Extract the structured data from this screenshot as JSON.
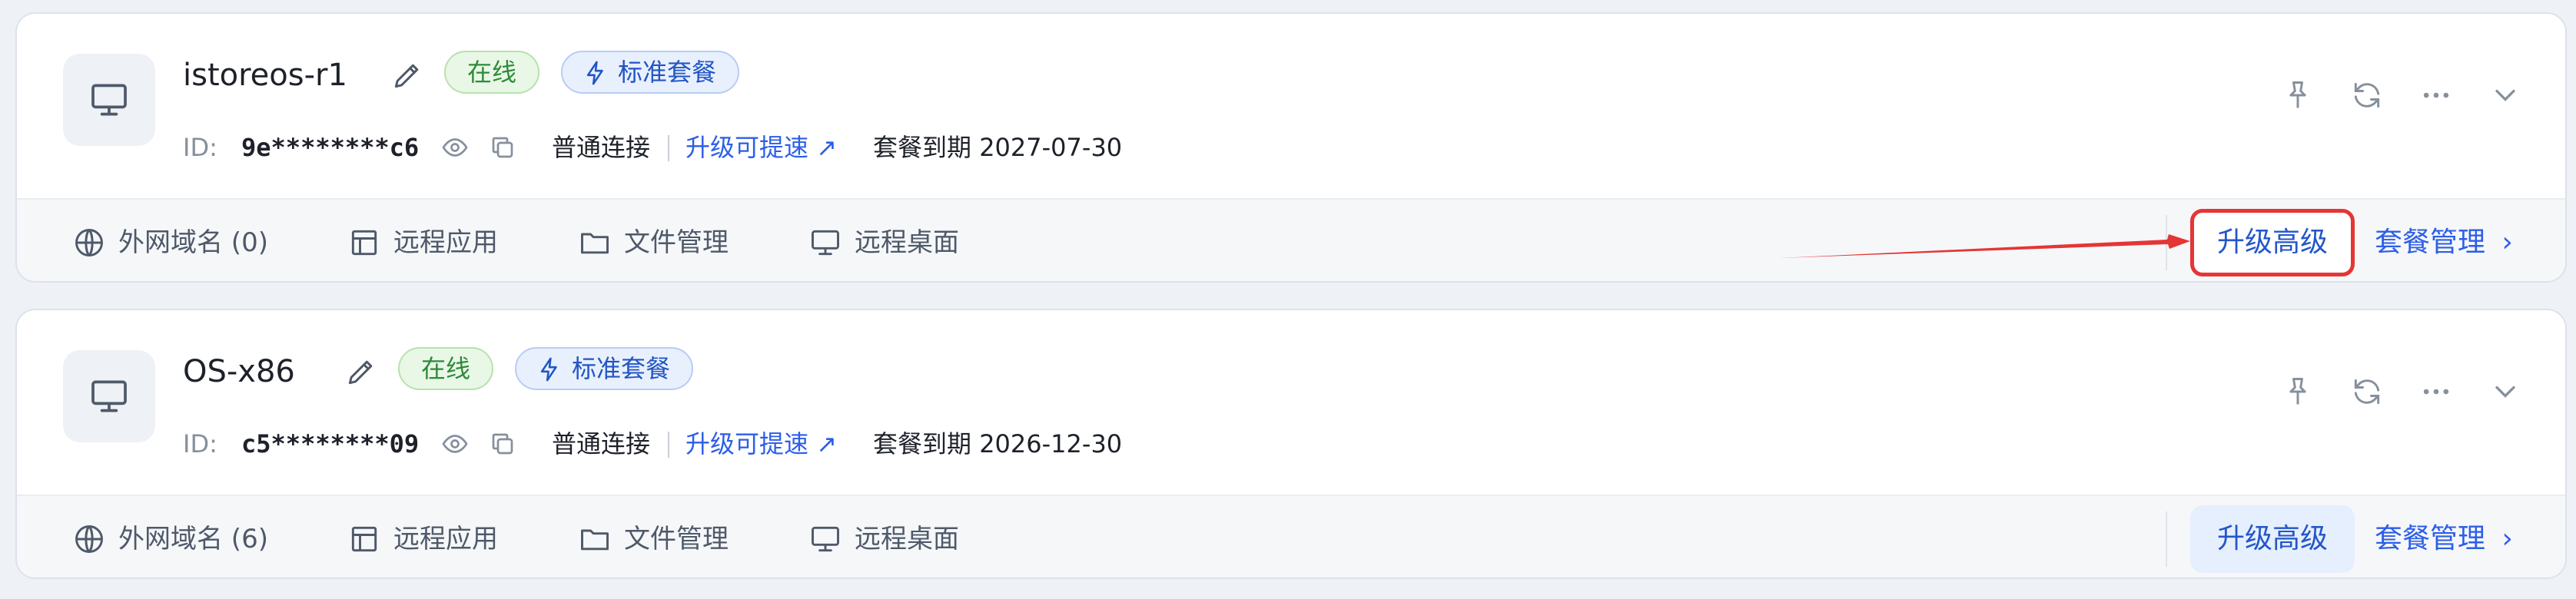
{
  "devices": [
    {
      "name": "istoreos-r1",
      "status": "在线",
      "plan": "标准套餐",
      "id_label": "ID:",
      "id_value": "9e********c6",
      "connection": "普通连接",
      "upgrade_speed": "升级可提速",
      "upgrade_speed_arrow": "↗",
      "expiry_label": "套餐到期",
      "expiry_date": "2027-07-30",
      "domains": "外网域名 (0)",
      "remote_app": "远程应用",
      "file_manage": "文件管理",
      "remote_desktop": "远程桌面",
      "upgrade_btn": "升级高级",
      "plan_manage": "套餐管理",
      "plan_manage_chevron": "›"
    },
    {
      "name": "OS-x86",
      "status": "在线",
      "plan": "标准套餐",
      "id_label": "ID:",
      "id_value": "c5********09",
      "connection": "普通连接",
      "upgrade_speed": "升级可提速",
      "upgrade_speed_arrow": "↗",
      "expiry_label": "套餐到期",
      "expiry_date": "2026-12-30",
      "domains": "外网域名 (6)",
      "remote_app": "远程应用",
      "file_manage": "文件管理",
      "remote_desktop": "远程桌面",
      "upgrade_btn": "升级高级",
      "plan_manage": "套餐管理",
      "plan_manage_chevron": "›"
    }
  ],
  "colors": {
    "accent": "#2c5ee8",
    "online_green": "#2e8b3a",
    "highlight_red": "#e53535"
  },
  "icons": [
    "monitor-icon",
    "pencil-icon",
    "lightning-icon",
    "eye-icon",
    "copy-icon",
    "pin-icon",
    "refresh-icon",
    "more-icon",
    "chevron-down-icon",
    "globe-icon",
    "layout-icon",
    "folder-icon",
    "desktop-icon"
  ]
}
